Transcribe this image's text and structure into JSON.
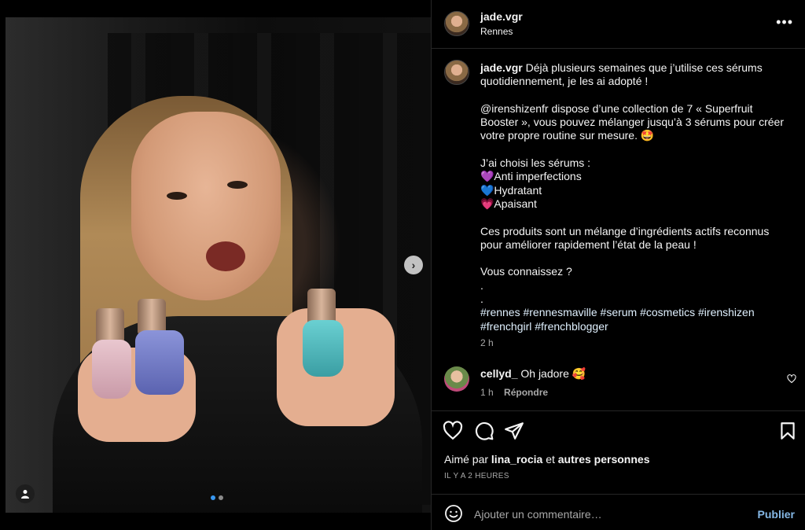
{
  "post": {
    "username": "jade.vgr",
    "location": "Rennes",
    "more_icon": "more-horizontal-icon",
    "caption_lines": [
      "Déjà plusieurs semaines que j’utilise ces sérums",
      "quotidiennement, je les ai adopté !",
      "",
      "@irenshizenfr dispose d’une collection de 7 « Superfruit",
      "Booster », vous pouvez mélanger jusqu’à 3 sérums pour créer",
      "votre propre routine sur mesure. 🤩",
      "",
      "J’ai choisi les sérums :",
      "💜Anti imperfections",
      "💙Hydratant",
      "💗Apaisant",
      "",
      "Ces produits sont un mélange d’ingrédients actifs reconnus",
      "pour améliorer rapidement l’état de la peau !",
      "",
      "Vous connaissez ?",
      ".",
      ".",
      "#rennes #rennesmaville #serum #cosmetics #irenshizen",
      "#frenchgirl #frenchblogger"
    ],
    "caption_time": "2 h"
  },
  "comments": [
    {
      "username": "cellyd_",
      "text": "Oh jadore 🥰",
      "time": "1 h",
      "reply_label": "Répondre"
    }
  ],
  "likes": {
    "prefix": "Aimé par",
    "user": "lina_rocia",
    "connector": "et",
    "others": "autres personnes"
  },
  "posted_ago": "IL Y A 2 HEURES",
  "composer": {
    "placeholder": "Ajouter un commentaire…",
    "publish_label": "Publier"
  },
  "carousel": {
    "total": 2,
    "current": 1
  },
  "colors": {
    "background": "#000000",
    "text": "#f5f5f5",
    "secondary": "#a8a8a8",
    "publish": "#85b8e6",
    "active_dot": "#3897f0"
  }
}
